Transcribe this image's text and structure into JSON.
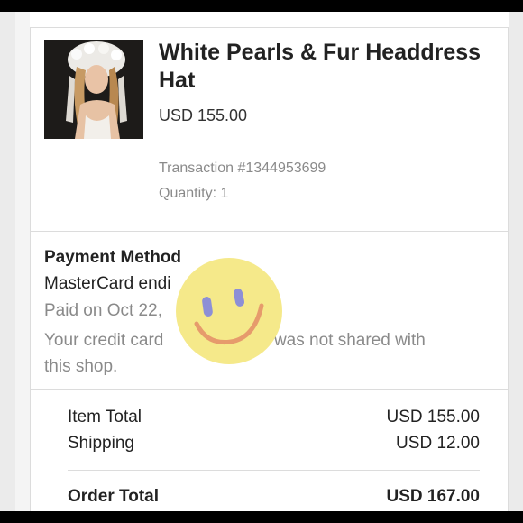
{
  "product": {
    "title": "White Pearls & Fur Headdress Hat",
    "price": "USD 155.00",
    "transaction": "Transaction #1344953699",
    "quantity": "Quantity: 1",
    "image": "headdress-photo"
  },
  "payment": {
    "title": "Payment Method",
    "card_line": "MasterCard endi",
    "paid_line": "Paid on Oct 22,",
    "note_line_1_start": "Your credit card",
    "note_line_1_end": "was not shared with",
    "note_line_2": "this shop.",
    "overlay": "smiley-face-sticker"
  },
  "totals": {
    "item_total_label": "Item Total",
    "item_total_value": "USD 155.00",
    "shipping_label": "Shipping",
    "shipping_value": "USD 12.00",
    "order_total_label": "Order Total",
    "order_total_value": "USD 167.00"
  },
  "colors": {
    "sticker_fill": "#f5e98a",
    "sticker_eyes": "#8d8fd6",
    "sticker_smile": "#e69b6c"
  }
}
